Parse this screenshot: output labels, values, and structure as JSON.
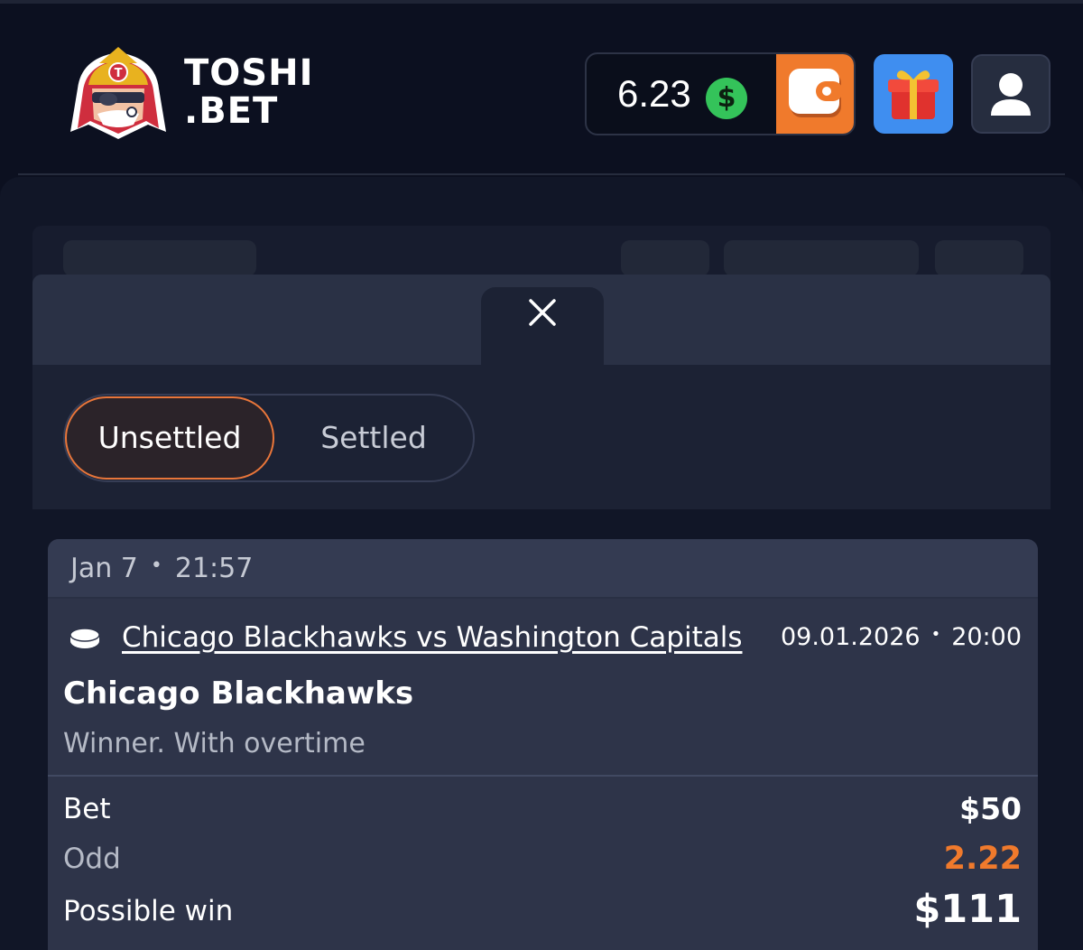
{
  "header": {
    "brand_line1": "TOSHI",
    "brand_line2": ".BET",
    "balance": "6.23",
    "currency_symbol": "$",
    "icons": {
      "logo": "samurai-mascot-logo",
      "wallet": "wallet-icon",
      "gift": "gift-icon",
      "user": "user-icon"
    },
    "colors": {
      "wallet_bg": "#f07a2c",
      "gift_bg": "#3f8ef0",
      "dollar_bg": "#34c35a"
    }
  },
  "tabs": {
    "unsettled": "Unsettled",
    "settled": "Settled",
    "active": "Unsettled"
  },
  "bet": {
    "placed_date": "Jan 7",
    "placed_time": "21:57",
    "sport_icon": "hockey-puck-icon",
    "match": "Chicago Blackhawks vs Washington Capitals",
    "match_date": "09.01.2026",
    "match_time": "20:00",
    "pick": "Chicago Blackhawks",
    "market": "Winner. With overtime",
    "bet_label": "Bet",
    "bet_value": "$50",
    "odd_label": "Odd",
    "odd_value": "2.22",
    "win_label": "Possible win",
    "win_value": "$111"
  },
  "colors": {
    "accent": "#e9763a",
    "odd_color": "#f07a2c",
    "background": "#0c1020",
    "card": "#2e3449"
  }
}
